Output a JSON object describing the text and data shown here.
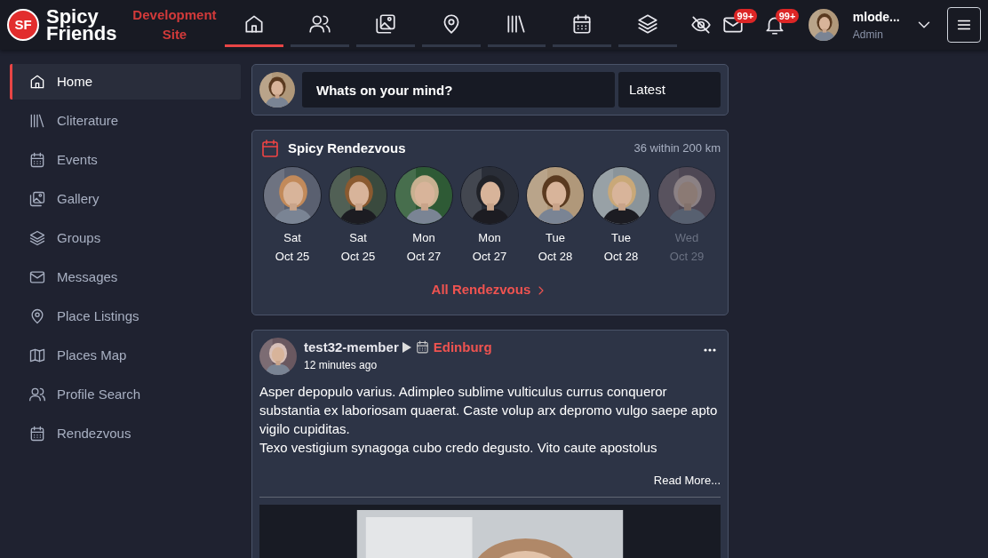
{
  "logo": {
    "mark": "SF",
    "name_top": "Spicy",
    "name_bottom": "Friends"
  },
  "site_label": "Development Site",
  "nav_tabs": [
    {
      "selected": true
    },
    {
      "selected": false
    },
    {
      "selected": false
    },
    {
      "selected": false
    },
    {
      "selected": false
    },
    {
      "selected": false
    },
    {
      "selected": false
    }
  ],
  "header_actions": {
    "messages_badge": "99+",
    "notifications_badge": "99+"
  },
  "user": {
    "name": "mlode...",
    "role": "Admin"
  },
  "sidebar": {
    "items": [
      {
        "label": "Home",
        "selected": true
      },
      {
        "label": "Cliterature",
        "selected": false
      },
      {
        "label": "Events",
        "selected": false
      },
      {
        "label": "Gallery",
        "selected": false
      },
      {
        "label": "Groups",
        "selected": false
      },
      {
        "label": "Messages",
        "selected": false
      },
      {
        "label": "Place Listings",
        "selected": false
      },
      {
        "label": "Places Map",
        "selected": false
      },
      {
        "label": "Profile Search",
        "selected": false
      },
      {
        "label": "Rendezvous",
        "selected": false
      }
    ]
  },
  "composer": {
    "placeholder": "Whats on your mind?",
    "sort": "Latest"
  },
  "rendezvous": {
    "title": "Spicy Rendezvous",
    "summary": "36 within 200 km",
    "link": "All Rendezvous",
    "people": [
      {
        "day": "Sat",
        "date": "Oct 25",
        "faded": false
      },
      {
        "day": "Sat",
        "date": "Oct 25",
        "faded": false
      },
      {
        "day": "Mon",
        "date": "Oct 27",
        "faded": false
      },
      {
        "day": "Mon",
        "date": "Oct 27",
        "faded": false
      },
      {
        "day": "Tue",
        "date": "Oct 28",
        "faded": false
      },
      {
        "day": "Tue",
        "date": "Oct 28",
        "faded": false
      },
      {
        "day": "Wed",
        "date": "Oct 29",
        "faded": true
      }
    ]
  },
  "post": {
    "author": "test32-member",
    "event": "Edinburg",
    "time": "12 minutes ago",
    "paragraphs": [
      "Asper depopulo varius. Adimpleo sublime vulticulus currus conqueror substantia ex laboriosam quaerat. Caste volup arx depromo vulgo saepe apto vigilo cupiditas.",
      "Texo vestigium synagoga cubo credo degusto. Vito caute apostolus"
    ],
    "read_more": "Read More..."
  }
}
